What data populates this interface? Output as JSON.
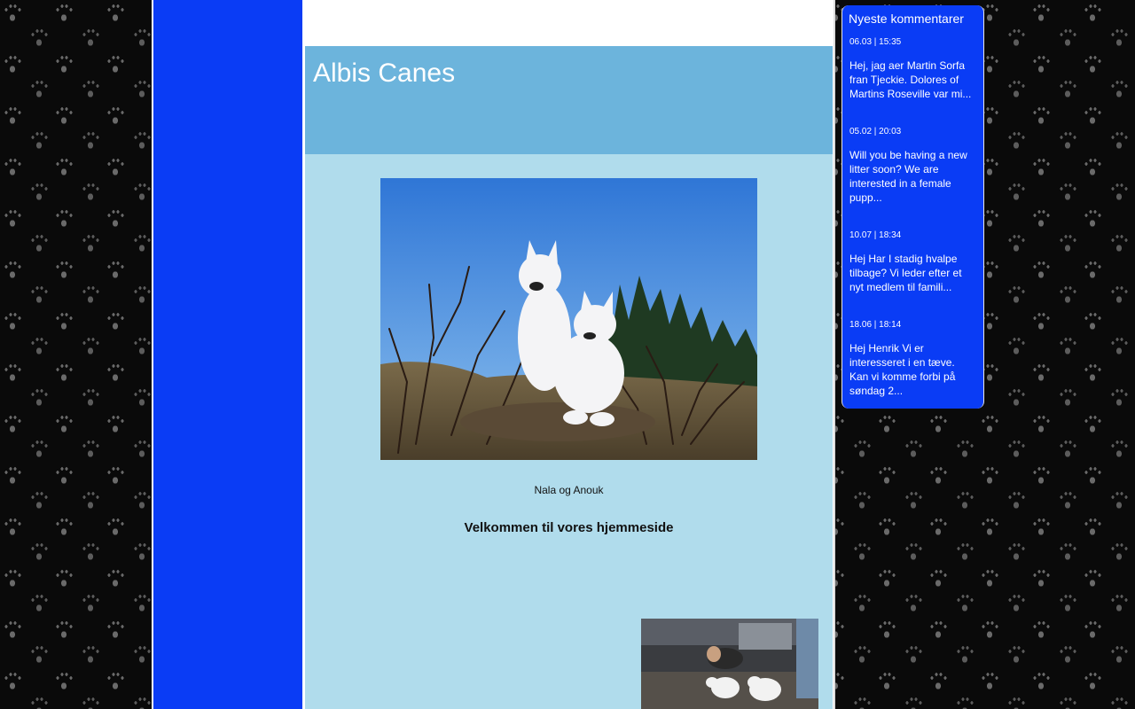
{
  "header": {
    "site_title": "Albis Canes"
  },
  "main": {
    "photo_caption": "Nala og Anouk",
    "welcome_heading": "Velkommen til vores hjemmeside"
  },
  "comments": {
    "title": "Nyeste kommentarer",
    "items": [
      {
        "date": "06.03 | 15:35",
        "text": "Hej, jag aer Martin Sorfa fran Tjeckie. Dolores of Martins Roseville var mi..."
      },
      {
        "date": "05.02 | 20:03",
        "text": "Will you be having a new litter soon? We are interested in a female pupp..."
      },
      {
        "date": "10.07 | 18:34",
        "text": "Hej Har I stadig hvalpe tilbage? Vi leder efter et nyt medlem til famili..."
      },
      {
        "date": "18.06 | 18:14",
        "text": "Hej Henrik Vi er interesseret i en tæve. Kan vi komme forbi på søndag 2..."
      }
    ]
  },
  "colors": {
    "sidebar_blue": "#0a3cf5",
    "header_blue": "#6cb4dc",
    "content_light_blue": "#b0dcec",
    "page_background": "#0a0a0a"
  },
  "images": {
    "main_photo": "two-white-shepherd-dogs-photo",
    "small_photo": "people-with-white-puppies-photo"
  }
}
